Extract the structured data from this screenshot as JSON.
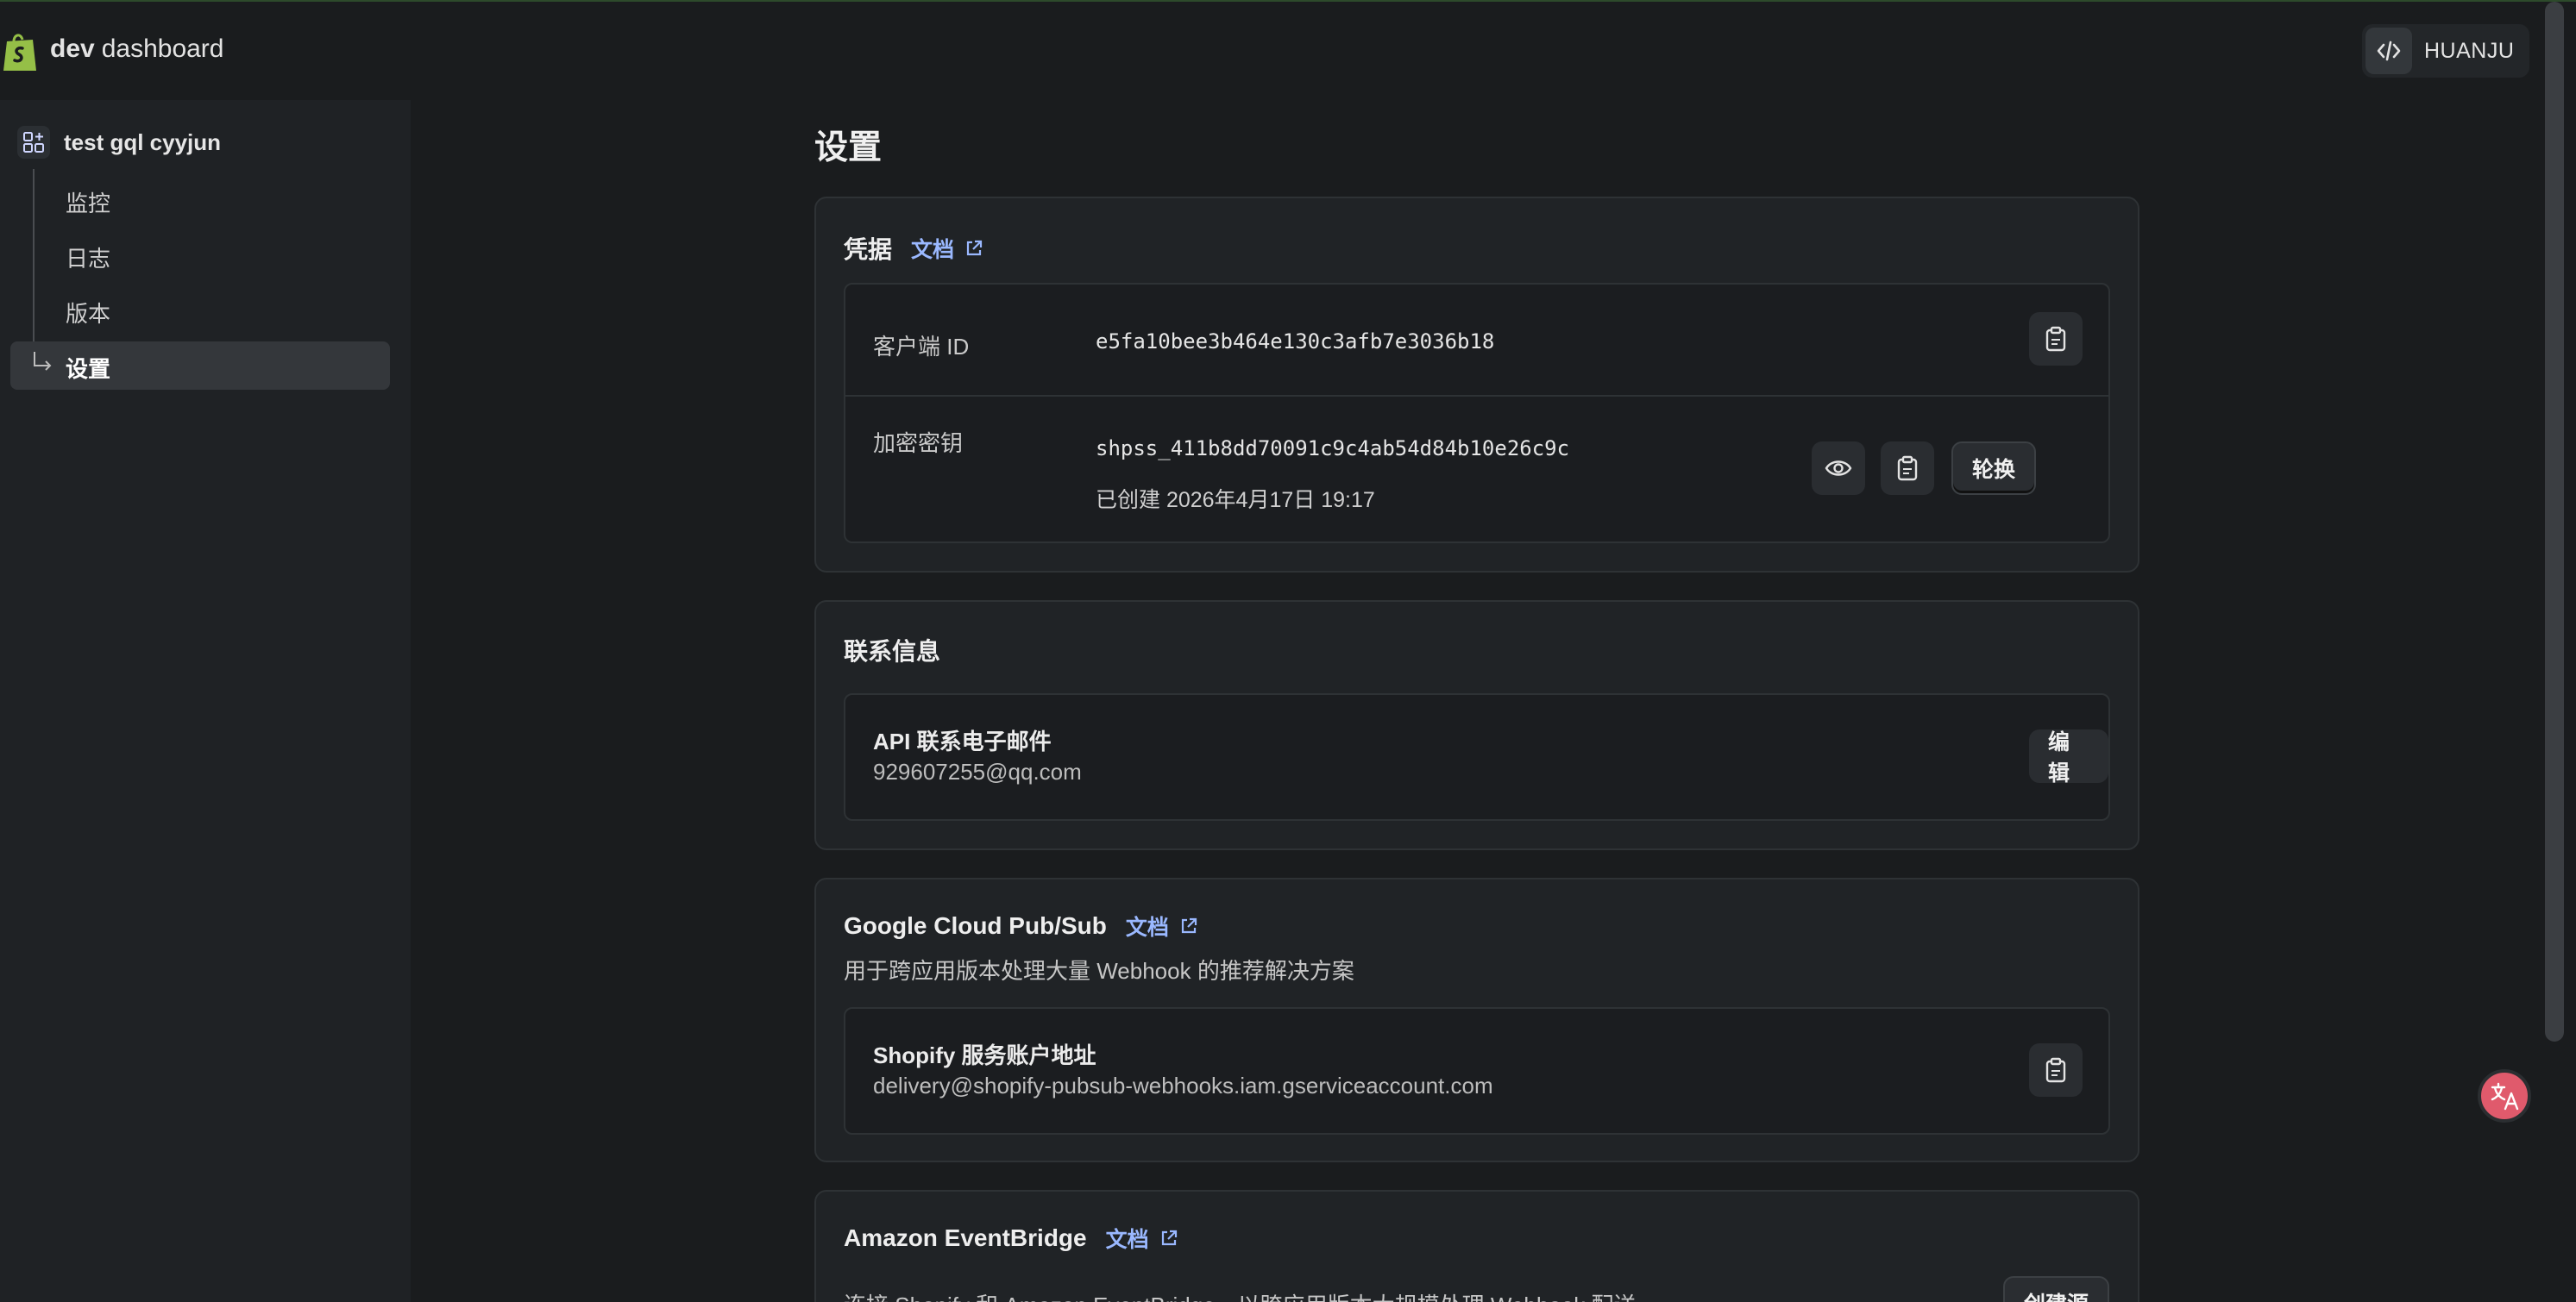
{
  "header": {
    "brand_bold": "dev",
    "brand_rest": "dashboard",
    "org_name": "HUANJU",
    "logo_icon": "shopify-bag-icon",
    "code_icon": "code-icon"
  },
  "sidebar": {
    "project": "test gql cyyjun",
    "items": [
      {
        "label": "监控"
      },
      {
        "label": "日志"
      },
      {
        "label": "版本"
      },
      {
        "label": "设置",
        "active": true
      }
    ]
  },
  "main": {
    "title": "设置",
    "credentials": {
      "title": "凭据",
      "doc_link": "文档",
      "client_id_label": "客户端 ID",
      "client_id_value": "e5fa10bee3b464e130c3afb7e3036b18",
      "secret_label": "加密密钥",
      "secret_value": "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",
      "secret_created": "已创建 2026年4月17日 19:17",
      "rotate_label": "轮换"
    },
    "contact": {
      "title": "联系信息",
      "email_label": "API 联系电子邮件",
      "email_value": "929607255@qq.com",
      "edit_label": "编辑"
    },
    "pubsub": {
      "title": "Google Cloud Pub/Sub",
      "doc_link": "文档",
      "description": "用于跨应用版本处理大量 Webhook 的推荐解决方案",
      "account_label": "Shopify 服务账户地址",
      "account_value": "delivery@shopify-pubsub-webhooks.iam.gserviceaccount.com"
    },
    "eventbridge": {
      "title": "Amazon EventBridge",
      "doc_link": "文档",
      "description": "连接 Shopify 和 Amazon EventBridge，以跨应用版本大规模处理 Webhook 配送",
      "create_label": "创建源"
    }
  },
  "colors": {
    "background": "#1a1c1e",
    "card": "#202326",
    "link": "#9ab8ff",
    "brand_green": "#95bf47"
  }
}
